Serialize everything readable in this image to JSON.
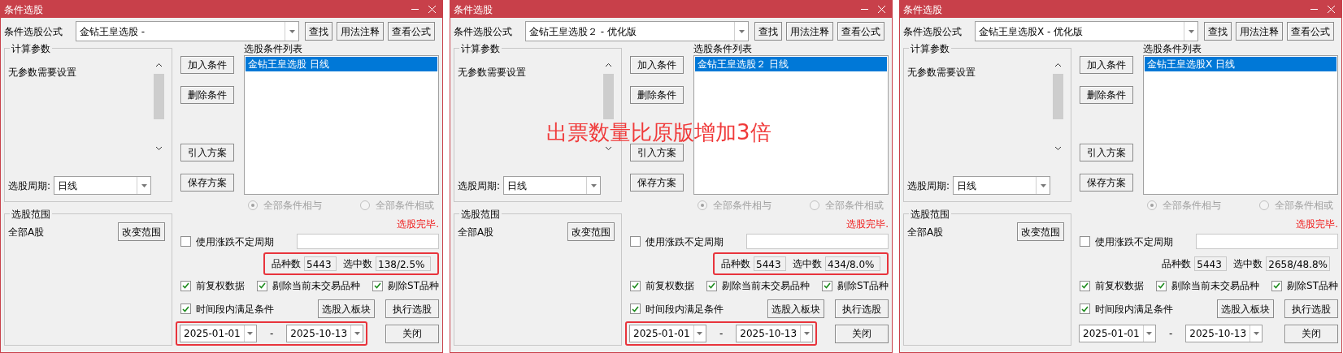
{
  "windows": [
    {
      "title": "条件选股",
      "formula_label": "条件选股公式",
      "formula": "金钻王皇选股  -",
      "buttons": [
        "查找",
        "用法注释",
        "查看公式"
      ],
      "params_group": {
        "title": "计算参数",
        "text": "无参数需要设置"
      },
      "period": {
        "label": "选股周期:",
        "value": "日线"
      },
      "range_group": {
        "title": "选股范围",
        "text": "全部A股",
        "button": "改变范围"
      },
      "side_buttons": [
        "加入条件",
        "删除条件",
        "引入方案",
        "保存方案"
      ],
      "conditions": {
        "title": "选股条件列表",
        "items": [
          {
            "text": "金钻王皇选股  日线",
            "selected": true
          }
        ]
      },
      "logic": [
        {
          "label": "全部条件相与",
          "selected": true,
          "disabled": true
        },
        {
          "label": "全部条件相或",
          "selected": false,
          "disabled": true
        }
      ],
      "status": "选股完毕.",
      "variable_period": {
        "label": "使用涨跌不定周期",
        "checked": false
      },
      "stats": {
        "highlighted": true,
        "total_label": "品种数",
        "total": "5443",
        "picked_label": "选中数",
        "picked": "138/2.5%"
      },
      "options": [
        {
          "label": "前复权数据",
          "checked": true
        },
        {
          "label": "剔除当前未交易品种",
          "checked": true
        },
        {
          "label": "剔除ST品种",
          "checked": true
        }
      ],
      "time_filter": {
        "label": "时间段内满足条件",
        "checked": true
      },
      "dates": {
        "highlighted": true,
        "from": "2025-01-01",
        "separator": "-",
        "to": "2025-10-13"
      },
      "action_buttons": [
        "选股入板块",
        "执行选股",
        "关闭"
      ]
    },
    {
      "title": "条件选股",
      "formula_label": "条件选股公式",
      "formula": "金钻王皇选股２ -  优化版",
      "buttons": [
        "查找",
        "用法注释",
        "查看公式"
      ],
      "params_group": {
        "title": "计算参数",
        "text": "无参数需要设置"
      },
      "period": {
        "label": "选股周期:",
        "value": "日线"
      },
      "range_group": {
        "title": "选股范围",
        "text": "全部A股",
        "button": "改变范围"
      },
      "side_buttons": [
        "加入条件",
        "删除条件",
        "引入方案",
        "保存方案"
      ],
      "conditions": {
        "title": "选股条件列表",
        "items": [
          {
            "text": "金钻王皇选股２ 日线",
            "selected": true
          }
        ]
      },
      "logic": [
        {
          "label": "全部条件相与",
          "selected": true,
          "disabled": true
        },
        {
          "label": "全部条件相或",
          "selected": false,
          "disabled": true
        }
      ],
      "status": "选股完毕.",
      "variable_period": {
        "label": "使用涨跌不定周期",
        "checked": false
      },
      "stats": {
        "highlighted": true,
        "total_label": "品种数",
        "total": "5443",
        "picked_label": "选中数",
        "picked": "434/8.0%"
      },
      "options": [
        {
          "label": "前复权数据",
          "checked": true
        },
        {
          "label": "剔除当前未交易品种",
          "checked": true
        },
        {
          "label": "剔除ST品种",
          "checked": true
        }
      ],
      "time_filter": {
        "label": "时间段内满足条件",
        "checked": true
      },
      "dates": {
        "highlighted": true,
        "from": "2025-01-01",
        "separator": "-",
        "to": "2025-10-13"
      },
      "action_buttons": [
        "选股入板块",
        "执行选股",
        "关闭"
      ],
      "note": "出票数量比原版增加3倍"
    },
    {
      "title": "条件选股",
      "formula_label": "条件选股公式",
      "formula": "金钻王皇选股X  -  优化版",
      "buttons": [
        "查找",
        "用法注释",
        "查看公式"
      ],
      "params_group": {
        "title": "计算参数",
        "text": "无参数需要设置"
      },
      "period": {
        "label": "选股周期:",
        "value": "日线"
      },
      "range_group": {
        "title": "选股范围",
        "text": "全部A股",
        "button": "改变范围"
      },
      "side_buttons": [
        "加入条件",
        "删除条件",
        "引入方案",
        "保存方案"
      ],
      "conditions": {
        "title": "选股条件列表",
        "items": [
          {
            "text": "金钻王皇选股X  日线",
            "selected": true
          }
        ]
      },
      "logic": [
        {
          "label": "全部条件相与",
          "selected": true,
          "disabled": true
        },
        {
          "label": "全部条件相或",
          "selected": false,
          "disabled": true
        }
      ],
      "status": "选股完毕.",
      "variable_period": {
        "label": "使用涨跌不定周期",
        "checked": false
      },
      "stats": {
        "highlighted": false,
        "total_label": "品种数",
        "total": "5443",
        "picked_label": "选中数",
        "picked": "2658/48.8%"
      },
      "options": [
        {
          "label": "前复权数据",
          "checked": true
        },
        {
          "label": "剔除当前未交易品种",
          "checked": true
        },
        {
          "label": "剔除ST品种",
          "checked": true
        }
      ],
      "time_filter": {
        "label": "时间段内满足条件",
        "checked": true
      },
      "dates": {
        "highlighted": false,
        "from": "2025-01-01",
        "separator": "-",
        "to": "2025-10-13"
      },
      "action_buttons": [
        "选股入板块",
        "执行选股",
        "关闭"
      ]
    }
  ]
}
